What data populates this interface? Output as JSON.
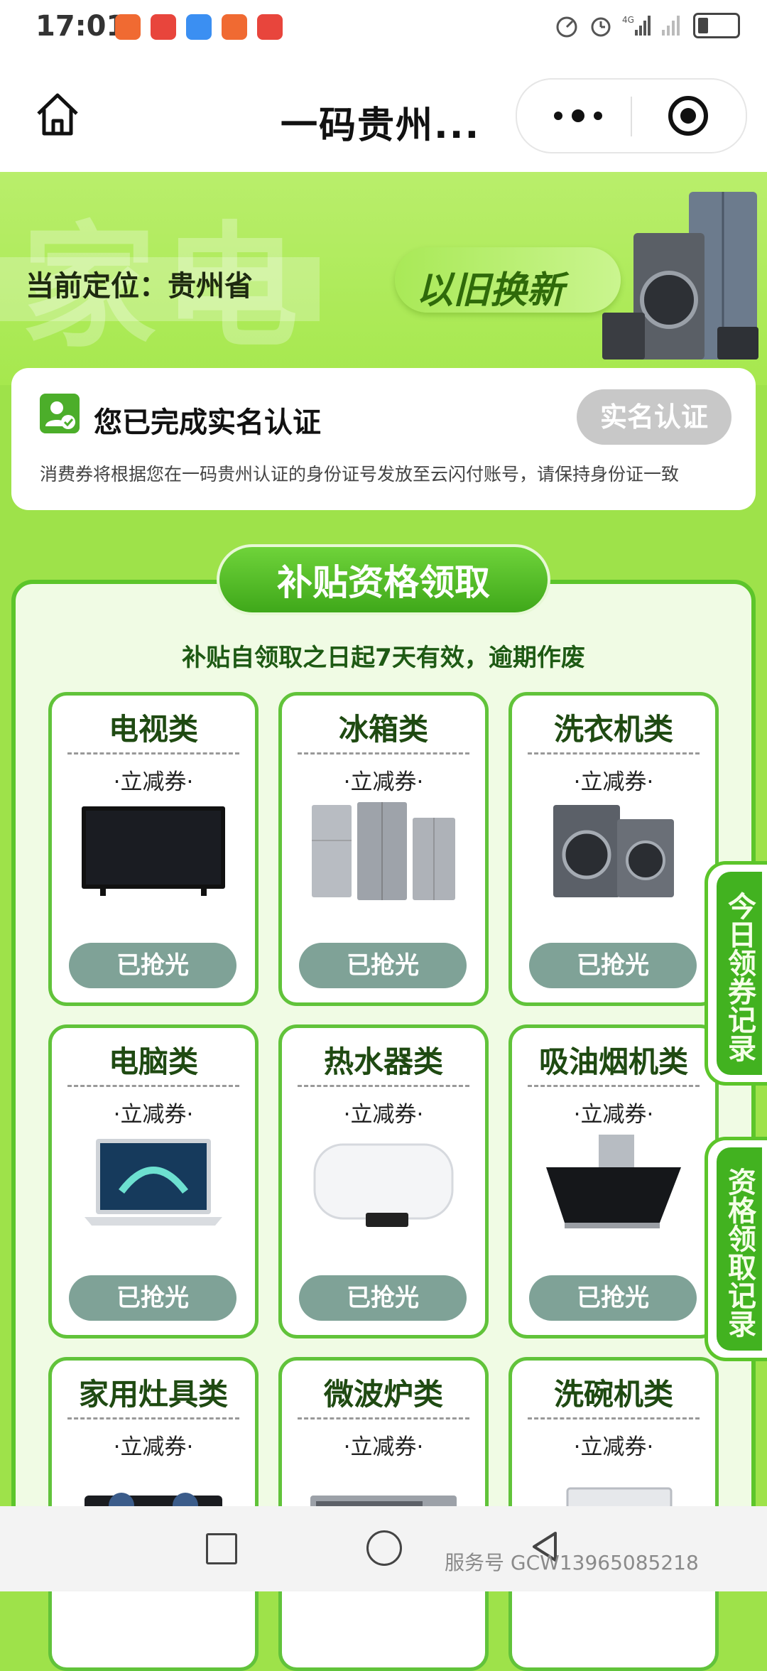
{
  "status_bar": {
    "time": "17:01",
    "network": "4G"
  },
  "nav": {
    "title": "一码贵州..."
  },
  "banner": {
    "watermark": "家电",
    "location": "当前定位：贵州省",
    "slogan": "以旧换新"
  },
  "auth": {
    "message": "您已完成实名认证",
    "button": "实名认证",
    "note": "消费券将根据您在一码贵州认证的身份证号发放至云闪付账号，请保持身份证一致"
  },
  "panel": {
    "title": "补贴资格领取",
    "subtitle": "补贴自领取之日起7天有效，逾期作废",
    "cards": [
      {
        "name": "电视类",
        "type": "·立减券·",
        "status": "已抢光",
        "icon": "tv-icon"
      },
      {
        "name": "冰箱类",
        "type": "·立减券·",
        "status": "已抢光",
        "icon": "fridge-icon"
      },
      {
        "name": "洗衣机类",
        "type": "·立减券·",
        "status": "已抢光",
        "icon": "washer-icon"
      },
      {
        "name": "电脑类",
        "type": "·立减券·",
        "status": "已抢光",
        "icon": "laptop-icon"
      },
      {
        "name": "热水器类",
        "type": "·立减券·",
        "status": "已抢光",
        "icon": "water-heater-icon"
      },
      {
        "name": "吸油烟机类",
        "type": "·立减券·",
        "status": "已抢光",
        "icon": "range-hood-icon"
      },
      {
        "name": "家用灶具类",
        "type": "·立减券·",
        "status": "",
        "icon": "stove-icon"
      },
      {
        "name": "微波炉类",
        "type": "·立减券·",
        "status": "",
        "icon": "microwave-icon"
      },
      {
        "name": "洗碗机类",
        "type": "·立减券·",
        "status": "",
        "icon": "dishwasher-icon"
      }
    ]
  },
  "side_tabs": {
    "today": "今日领券记录",
    "records": "资格领取记录"
  },
  "watermark": "服务号 GCW13965085218",
  "colors": {
    "brand_green": "#5cc52a",
    "sold_out_button": "#7fa297",
    "banner_green": "#a6e84e"
  }
}
